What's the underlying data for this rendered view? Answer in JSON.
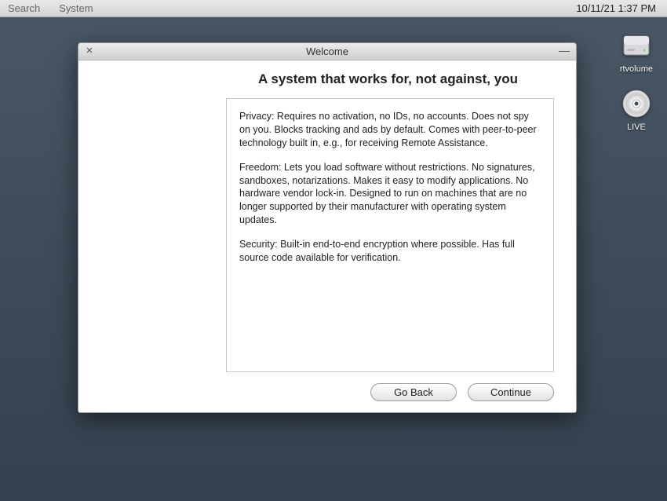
{
  "menubar": {
    "search": "Search",
    "system": "System",
    "datetime": "10/11/21 1:37 PM"
  },
  "desktop": {
    "disk_label": "rtvolume",
    "live_label": "LIVE"
  },
  "window": {
    "title": "Welcome",
    "heading": "A system that works for, not against, you",
    "para1": "Privacy: Requires no activation, no IDs, no accounts. Does not spy on you. Blocks tracking and ads by default. Comes with peer-to-peer technology built in, e.g., for receiving Remote Assistance.",
    "para2": "Freedom: Lets you load software without restrictions. No signatures, sandboxes, notarizations. Makes it easy to modify applications. No hardware vendor lock-in. Designed to run on machines that are no longer supported by their manufacturer with operating system updates.",
    "para3": "Security: Built-in end-to-end encryption where possible. Has full source code available for verification.",
    "goback": "Go Back",
    "continue": "Continue"
  }
}
